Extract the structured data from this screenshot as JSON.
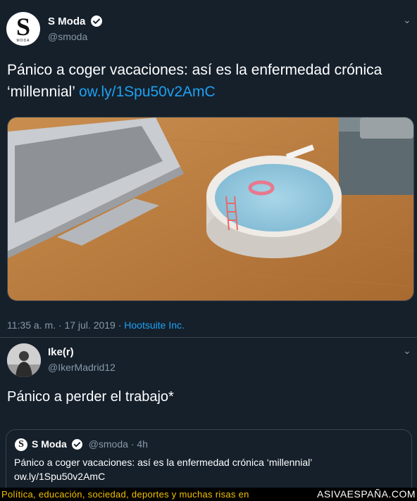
{
  "tweet": {
    "author_name": "S Moda",
    "author_handle": "@smoda",
    "avatar_letter": "S",
    "avatar_small": "MODA",
    "text": "Pánico a coger vacaciones: así es la enfermedad crónica ‘millennial’",
    "link": "ow.ly/1Spu50v2AmC",
    "timestamp": "11:35 a. m. · 17 jul. 2019 ·",
    "source": "Hootsuite Inc.",
    "image_icon": "laptop-and-pool-ashtray-illustration"
  },
  "reply": {
    "author_name": "Ike(r)",
    "author_handle": "@IkerMadrid12",
    "text": "Pánico a perder el trabajo*"
  },
  "quote": {
    "author_name": "S Moda",
    "author_handle": "@smoda · 4h",
    "avatar_letter": "S",
    "line1": "Pánico a coger vacaciones: así es la enfermedad crónica ‘millennial’",
    "line2": "ow.ly/1Spu50v2AmC"
  },
  "footer": {
    "text": "Política, educación, sociedad, deportes y muchas risas en",
    "brand": "ASIVAESPAÑA.COM"
  },
  "icons": {
    "chevron": "⌄",
    "check": "check-icon"
  },
  "colors": {
    "background": "#15202b",
    "accent": "#1da1f2",
    "muted": "#8899a6",
    "footer_text": "#f2c200"
  }
}
